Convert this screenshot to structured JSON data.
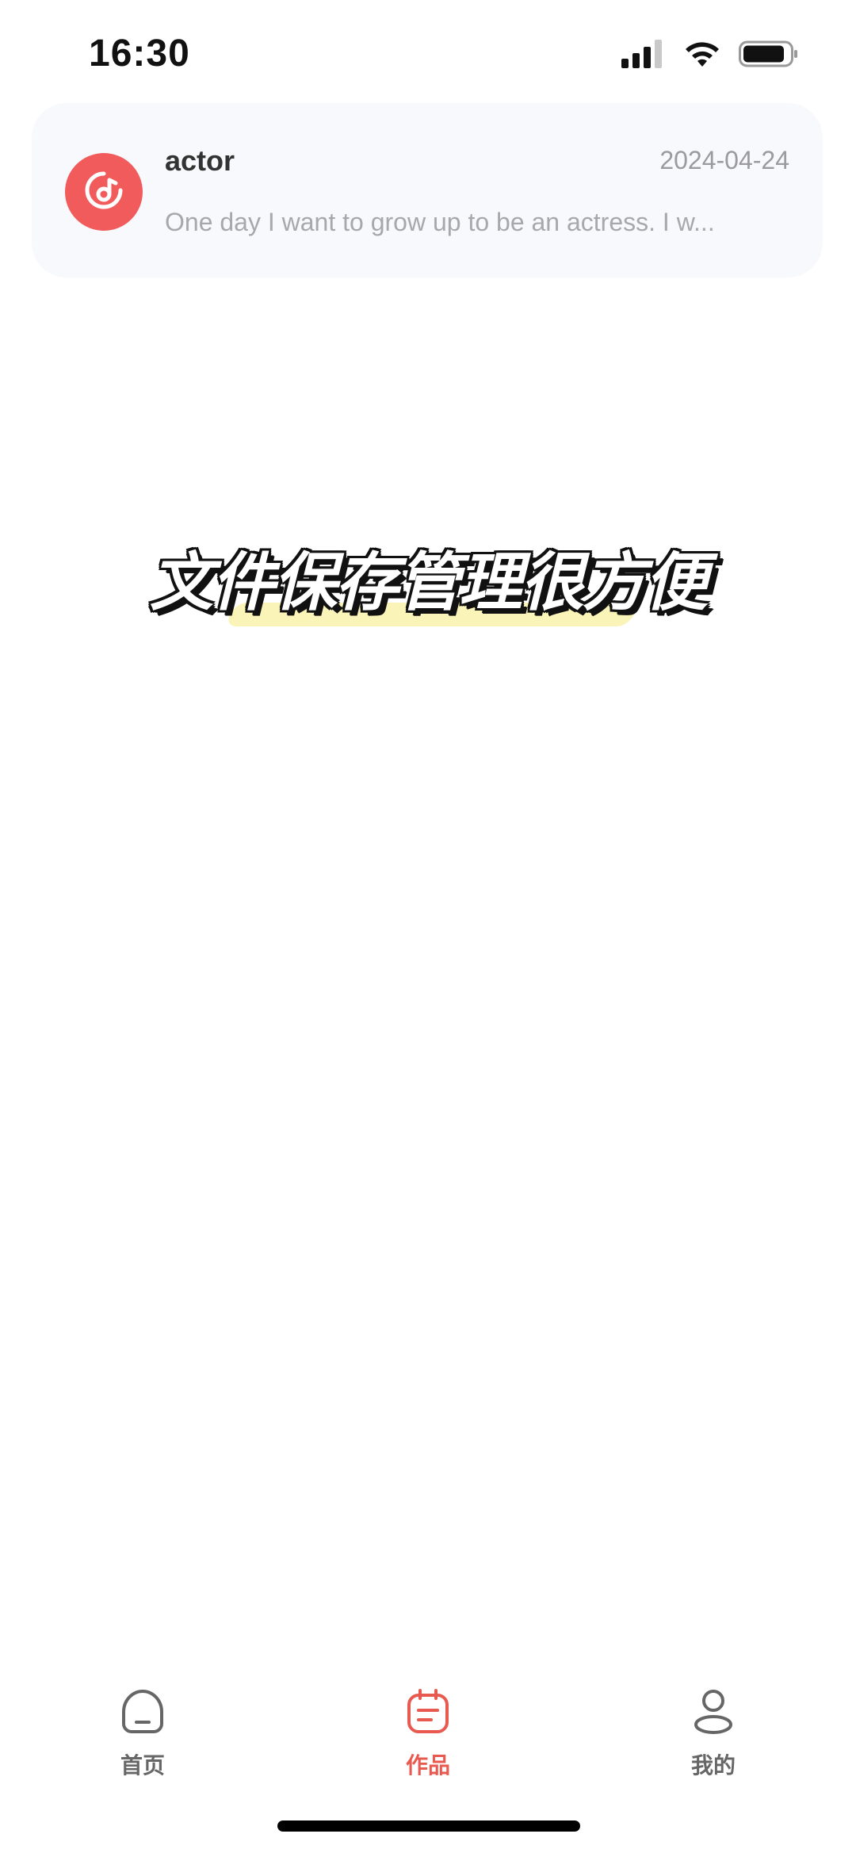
{
  "status_bar": {
    "time": "16:30",
    "icons": [
      "cellular-signal-icon",
      "wifi-icon",
      "battery-icon"
    ]
  },
  "card": {
    "icon": "music-disc-icon",
    "title": "actor",
    "date": "2024-04-24",
    "description": "One day I want to grow up to be an actress. I w..."
  },
  "promo": {
    "text": "文件保存管理很方便"
  },
  "tab_bar": {
    "tabs": [
      {
        "label": "首页",
        "icon": "home-icon",
        "active": false
      },
      {
        "label": "作品",
        "icon": "calendar-document-icon",
        "active": true
      },
      {
        "label": "我的",
        "icon": "person-icon",
        "active": false
      }
    ]
  },
  "colors": {
    "accent": "#e85a50",
    "avatar": "#f25b5b",
    "card_bg": "#f8f9fc",
    "highlight": "#fbf3b4"
  }
}
